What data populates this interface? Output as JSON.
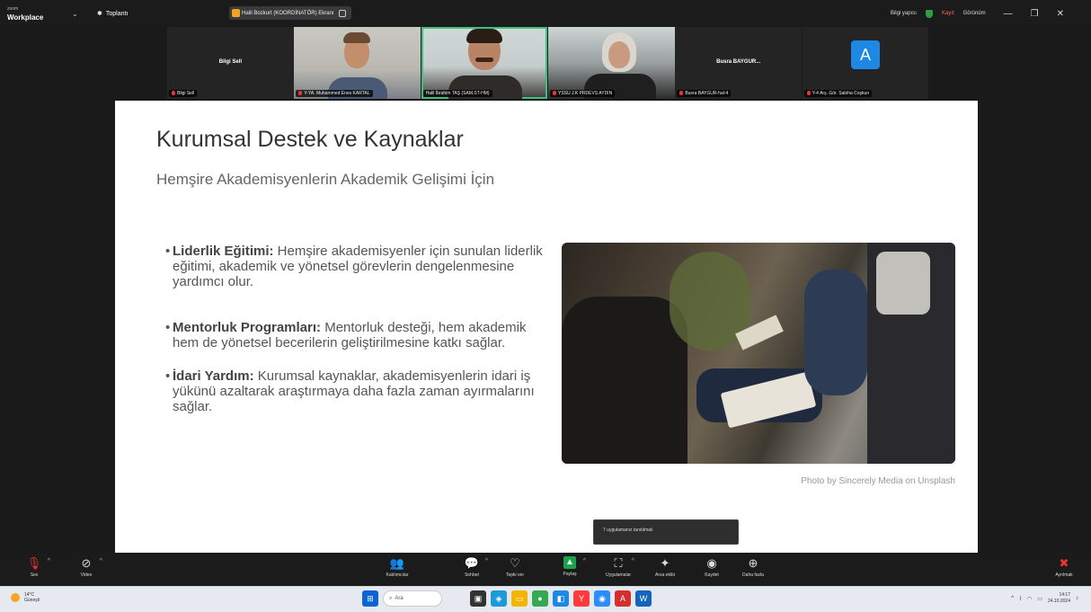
{
  "app": {
    "logo_small": "zoom",
    "logo_big": "Workplace",
    "menu_label": "Toplantı"
  },
  "meeting_pill": {
    "label": "Halil Bozkurt (KOORDİNATÖR) Ekranı"
  },
  "top_right": {
    "view_label": "Bilgi yapısı",
    "record_label": "Kayıt",
    "display_label": "Görünüm",
    "minimize": "—",
    "restore": "❐",
    "close": "✕"
  },
  "participants": [
    {
      "name": "Bilgi Sell",
      "center_name": "Bilgi Sell",
      "muted": true
    },
    {
      "name": "Y-YA. Muhammed Enes KARTAL",
      "muted": true
    },
    {
      "name": "Halil İbrahim TAŞ (SAM.ST-HM)",
      "muted": false
    },
    {
      "name": "YSSU J.K PRDEVS AYDIN",
      "muted": true
    },
    {
      "name": "Busra BAYGUR-hal-4",
      "center_name": "Busra BAYGUR...",
      "muted": true
    },
    {
      "name": "Y-4 Arş. Gör. Sabiha Coşkun",
      "avatar": "A",
      "muted": true
    }
  ],
  "slide": {
    "title": "Kurumsal Destek ve Kaynaklar",
    "subtitle": "Hemşire Akademisyenlerin Akademik Gelişimi İçin",
    "bullets": [
      {
        "head": "Liderlik Eğitimi:",
        "body": " Hemşire akademisyenler için sunulan liderlik eğitimi, akademik ve yönetsel görevlerin dengelenmesine yardımcı olur."
      },
      {
        "head": "Mentorluk Programları:",
        "body": " Mentorluk desteği, hem akademik hem de yönetsel becerilerin geliştirilmesine katkı sağlar."
      },
      {
        "head": "İdari Yardım:",
        "body": " Kurumsal kaynaklar, akademisyenlerin idari iş yükünü azaltarak araştırmaya daha fazla zaman ayırmalarını sağlar."
      }
    ],
    "caption": "Photo by Sincerely Media on Unsplash"
  },
  "tooltip": {
    "text": "7 uygulamanız tanıtılmalı"
  },
  "toolbar": {
    "audio": "Ses",
    "video": "Video",
    "participants": "Katılımcılar",
    "chat": "Sohbet",
    "react": "Tepki ver",
    "share": "Paylaş",
    "apps": "Uygulamalar",
    "ai": "Arsa ekibi",
    "record": "Kaydet",
    "more": "Daha fazla",
    "leave": "Ayrılmak",
    "participants_count": "7"
  },
  "taskbar": {
    "weather_temp": "14°C",
    "weather_desc": "Güneşli",
    "search_placeholder": "Ara",
    "time": "14:17",
    "date": "24.10.2024"
  },
  "colors": {
    "active_speaker": "#3fbf7f",
    "share_green": "#1aa34a",
    "muted_red": "#e33333",
    "avatar_blue": "#1e88e5"
  }
}
